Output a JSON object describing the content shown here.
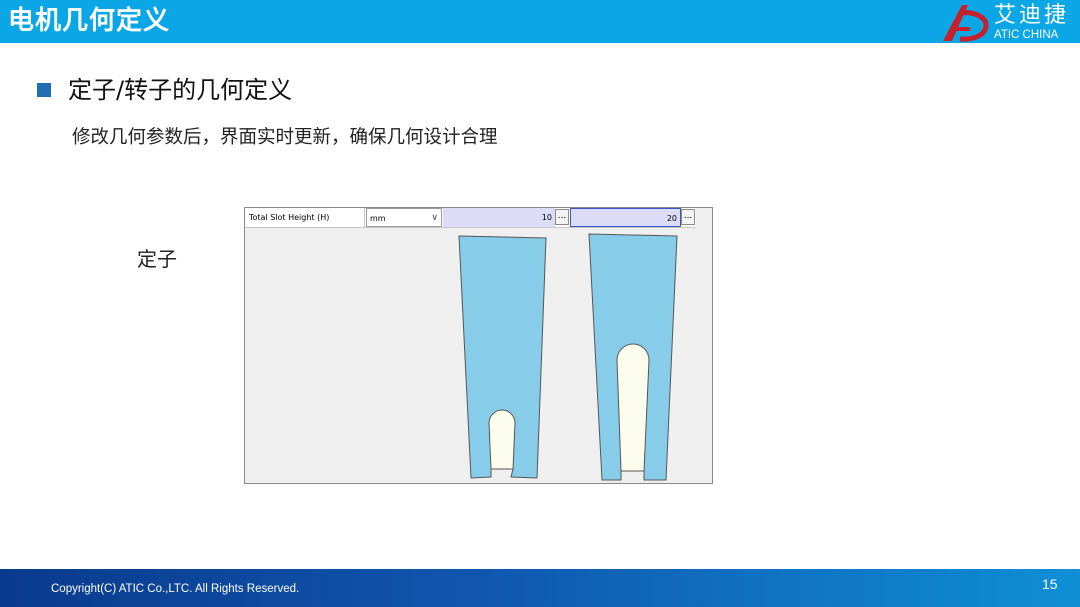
{
  "header": {
    "title": "电机几何定义",
    "logo_cn": "艾迪捷",
    "logo_en": "ATIC CHINA"
  },
  "content": {
    "heading": "定子/转子的几何定义",
    "description": "修改几何参数后，界面实时更新，确保几何设计合理",
    "side_label": "定子"
  },
  "editor": {
    "param_name": "Total Slot Height (H)",
    "unit": "mm",
    "value_1": "10",
    "value_2": "20",
    "dots_label": "..."
  },
  "colors": {
    "header_bg": "#0aa6e6",
    "slot_fill": "#87cdea",
    "slot_inner_fill": "#fdfdee",
    "selected_cell": "#dcdcf8"
  },
  "footer": {
    "copyright": "Copyright(C) ATIC Co.,LTC. All Rights Reserved.",
    "page_number": "15"
  }
}
